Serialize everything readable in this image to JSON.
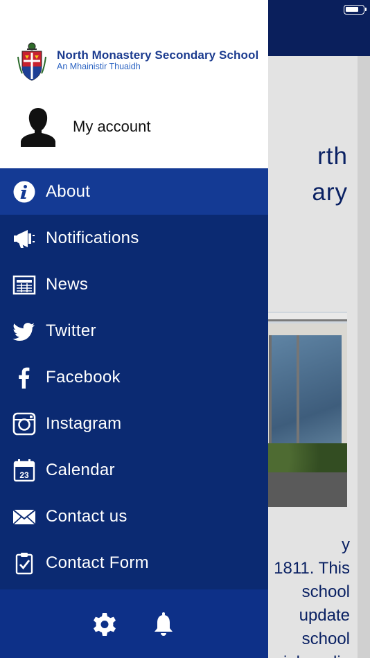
{
  "background_page": {
    "title_lines": [
      "rth",
      "ary"
    ],
    "body_lines": [
      "y",
      "1811. This",
      "school",
      "update",
      "school",
      "ial media"
    ]
  },
  "drawer": {
    "header": {
      "school_name": "North Monastery Secondary School",
      "school_subtitle": "An Mhainistir Thuaidh"
    },
    "account": {
      "label": "My account"
    },
    "menu": [
      {
        "label": "About",
        "icon": "info-icon",
        "active": true
      },
      {
        "label": "Notifications",
        "icon": "megaphone-icon",
        "active": false
      },
      {
        "label": "News",
        "icon": "newspaper-icon",
        "active": false
      },
      {
        "label": "Twitter",
        "icon": "twitter-icon",
        "active": false
      },
      {
        "label": "Facebook",
        "icon": "facebook-icon",
        "active": false
      },
      {
        "label": "Instagram",
        "icon": "instagram-icon",
        "active": false
      },
      {
        "label": "Calendar",
        "icon": "calendar-icon",
        "active": false,
        "icon_text": "23"
      },
      {
        "label": "Contact us",
        "icon": "envelope-icon",
        "active": false
      },
      {
        "label": "Contact Form",
        "icon": "clipboard-icon",
        "active": false
      }
    ],
    "footer": {
      "icons": [
        "settings-icon",
        "bell-icon"
      ]
    }
  },
  "colors": {
    "drawer_background": "#0b2a72",
    "active_item": "#143a94",
    "footer_background": "#0d3088",
    "header_background": "#ffffff",
    "school_name": "#1b3b8f",
    "school_subtitle": "#2b63c2",
    "top_bar": "#0a1f5c"
  }
}
